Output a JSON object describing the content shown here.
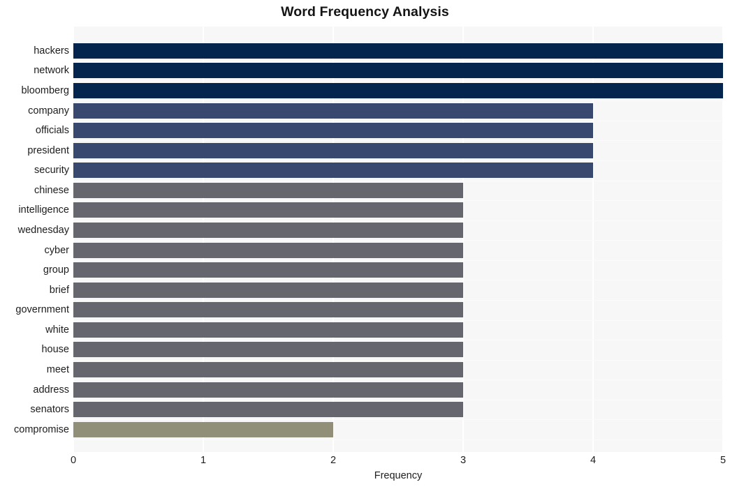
{
  "chart_data": {
    "type": "bar",
    "orientation": "horizontal",
    "title": "Word Frequency Analysis",
    "xlabel": "Frequency",
    "ylabel": "",
    "xlim": [
      0,
      5
    ],
    "xticks": [
      0,
      1,
      2,
      3,
      4,
      5
    ],
    "xtick_labels": [
      "0",
      "1",
      "2",
      "3",
      "4",
      "5"
    ],
    "grid": true,
    "grid_axis": "x",
    "legend": false,
    "categories": [
      "hackers",
      "network",
      "bloomberg",
      "company",
      "officials",
      "president",
      "security",
      "chinese",
      "intelligence",
      "wednesday",
      "cyber",
      "group",
      "brief",
      "government",
      "white",
      "house",
      "meet",
      "address",
      "senators",
      "compromise"
    ],
    "values": [
      5,
      5,
      5,
      4,
      4,
      4,
      4,
      3,
      3,
      3,
      3,
      3,
      3,
      3,
      3,
      3,
      3,
      3,
      3,
      2
    ],
    "bar_colors": [
      "#04254e",
      "#04254e",
      "#04254e",
      "#38486e",
      "#38486e",
      "#38486e",
      "#38486e",
      "#65666e",
      "#65666e",
      "#65666e",
      "#65666e",
      "#65666e",
      "#65666e",
      "#65666e",
      "#65666e",
      "#65666e",
      "#65666e",
      "#65666e",
      "#65666e",
      "#928f79"
    ],
    "plot_background": "#f7f7f8",
    "figure_background": "#ffffff",
    "gridline_color": "#ffffff"
  }
}
